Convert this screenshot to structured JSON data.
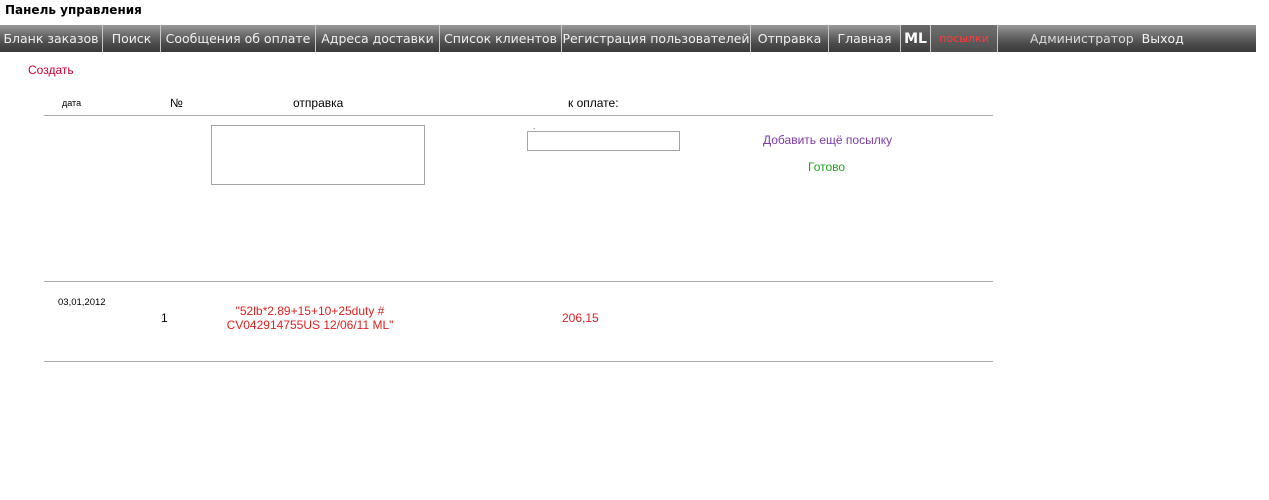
{
  "header": {
    "title": "Панель управления"
  },
  "nav": {
    "items": [
      {
        "label": "Бланк заказов"
      },
      {
        "label": "Поиск"
      },
      {
        "label": "Сообщения об оплате"
      },
      {
        "label": "Адреса доставки"
      },
      {
        "label": "Список клиентов"
      },
      {
        "label": "Регистрация пользователей"
      },
      {
        "label": "Отправка"
      },
      {
        "label": "Главная"
      },
      {
        "label": "ML"
      },
      {
        "label": "посылки"
      }
    ],
    "admin": "Администратор",
    "logout": "Выход"
  },
  "actions": {
    "create": "Создать",
    "add_parcel": "Добавить ещё посылку",
    "done": "Готово"
  },
  "table": {
    "headers": {
      "date": "дата",
      "number": "№",
      "shipment": "отправка",
      "amount": "к оплате:"
    },
    "form": {
      "shipment_value": "",
      "amount_value": "",
      "dot": "."
    },
    "rows": [
      {
        "date": "03,01,2012",
        "number": "1",
        "shipment": "\"52lb*2.89+15+10+25duty # CV042914755US 12/06/11 ML\"",
        "amount": "206,15"
      }
    ]
  },
  "colors": {
    "nav_gradient_top": "#9a9a9a",
    "nav_gradient_bottom": "#3a3a3a",
    "create_link": "#cc0033",
    "add_parcel_link": "#7a3aa8",
    "done_link": "#1aa31a",
    "row_text": "#dd2222",
    "parcels_text": "#ff3b3b"
  }
}
